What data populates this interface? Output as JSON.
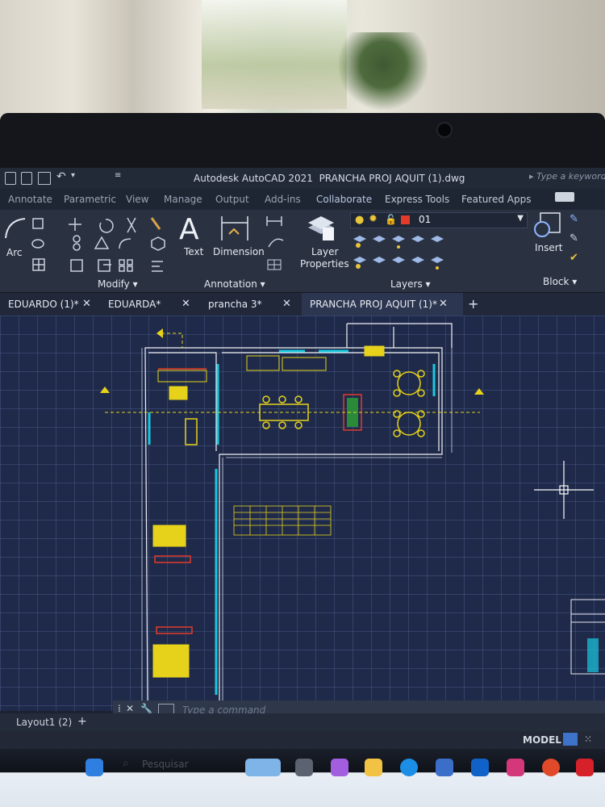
{
  "window": {
    "app_title": "Autodesk AutoCAD 2021",
    "file_name": "PRANCHA PROJ AQUIT (1).dwg",
    "search_placeholder": "Type a keyword"
  },
  "ribbon_tabs": [
    "Annotate",
    "Parametric",
    "View",
    "Manage",
    "Output",
    "Add-ins",
    "Collaborate",
    "Express Tools",
    "Featured Apps"
  ],
  "ribbon": {
    "draw_arc_label": "Arc",
    "modify_panel": "Modify",
    "text_label": "Text",
    "dimension_label": "Dimension",
    "annotation_panel": "Annotation",
    "layer_properties_label1": "Layer",
    "layer_properties_label2": "Properties",
    "layer_current": "01",
    "layers_panel": "Layers",
    "insert_label": "Insert",
    "block_panel": "Block"
  },
  "doc_tabs": [
    {
      "label": "EDUARDO (1)*"
    },
    {
      "label": "EDUARDA*"
    },
    {
      "label": "prancha 3*"
    },
    {
      "label": "PRANCHA PROJ AQUIT (1)*"
    }
  ],
  "command": {
    "placeholder": "Type a command"
  },
  "layout_tab": "Layout1 (2)",
  "status": {
    "model": "MODEL"
  },
  "taskbar": {
    "search_label": "Pesquisar"
  },
  "colors": {
    "accent_yellow": "#e6d21a",
    "cyan": "#19c8e0",
    "grid_bg": "#1f2a4a"
  }
}
